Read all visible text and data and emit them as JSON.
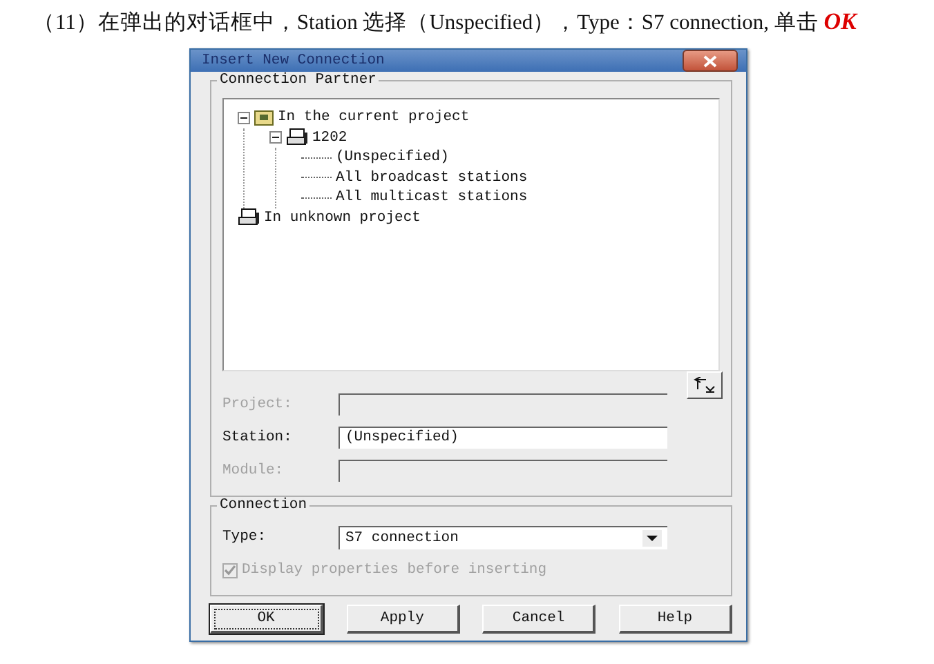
{
  "caption": {
    "text": "（11）在弹出的对话框中，Station 选择（Unspecified），Type：S7 connection, 单击",
    "emphasis": "OK"
  },
  "window": {
    "title": "Insert New Connection"
  },
  "connection_partner": {
    "title": "Connection Partner",
    "tree": [
      {
        "label": "In the current project",
        "kind": "folder",
        "expanded": true,
        "children": [
          {
            "label": "1202",
            "kind": "station",
            "expanded": true,
            "children": [
              {
                "label": "(Unspecified)",
                "kind": "leaf"
              },
              {
                "label": "All broadcast stations",
                "kind": "leaf"
              },
              {
                "label": "All multicast stations",
                "kind": "leaf"
              }
            ]
          }
        ]
      },
      {
        "label": "In unknown project",
        "kind": "station"
      }
    ],
    "fields": [
      {
        "label": "Project:",
        "disabled": true
      },
      {
        "label": "Station:",
        "value": "(Unspecified)",
        "disabled": false
      },
      {
        "label": "Module:",
        "disabled": true
      }
    ]
  },
  "connection": {
    "title": "Connection",
    "type_label": "Type:",
    "type_value": "S7 connection",
    "display_properties": {
      "label": "Display properties before inserting",
      "checked": true,
      "disabled": true
    }
  },
  "buttons": [
    {
      "label": "OK",
      "default": true
    },
    {
      "label": "Apply",
      "default": false
    },
    {
      "label": "Cancel",
      "default": false
    },
    {
      "label": "Help",
      "default": false
    }
  ]
}
